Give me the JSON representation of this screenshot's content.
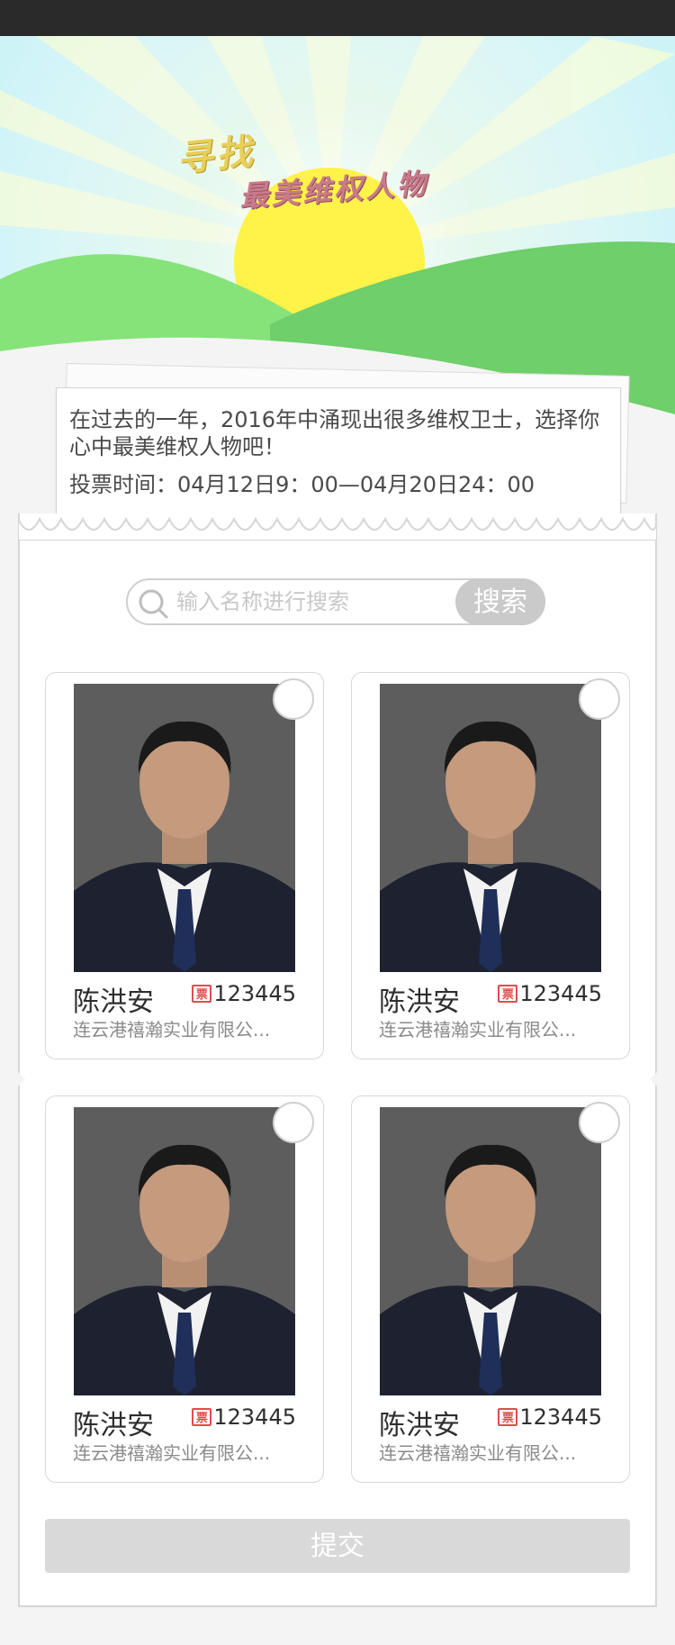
{
  "banner": {
    "title_line1": "寻找",
    "title_line2": "最美维权人物"
  },
  "intro": {
    "text": "在过去的一年，2016年中涌现出很多维权卫士，选择你心中最美维权人物吧！",
    "vote_time": "投票时间：04月12日9：00—04月20日24：00"
  },
  "search": {
    "placeholder": "输入名称进行搜索",
    "button_label": "搜索"
  },
  "candidates": [
    {
      "name": "陈洪安",
      "votes": "123445",
      "company": "连云港禧瀚实业有限公...",
      "vote_icon_label": "票"
    },
    {
      "name": "陈洪安",
      "votes": "123445",
      "company": "连云港禧瀚实业有限公...",
      "vote_icon_label": "票"
    },
    {
      "name": "陈洪安",
      "votes": "123445",
      "company": "连云港禧瀚实业有限公...",
      "vote_icon_label": "票"
    },
    {
      "name": "陈洪安",
      "votes": "123445",
      "company": "连云港禧瀚实业有限公...",
      "vote_icon_label": "票"
    }
  ],
  "submit_label": "提交",
  "colors": {
    "sky": "#cdf3f7",
    "sun": "#fff249",
    "hill_light": "#86e37a",
    "hill_dark": "#6fcf6a",
    "button_gray": "#cacaca"
  }
}
